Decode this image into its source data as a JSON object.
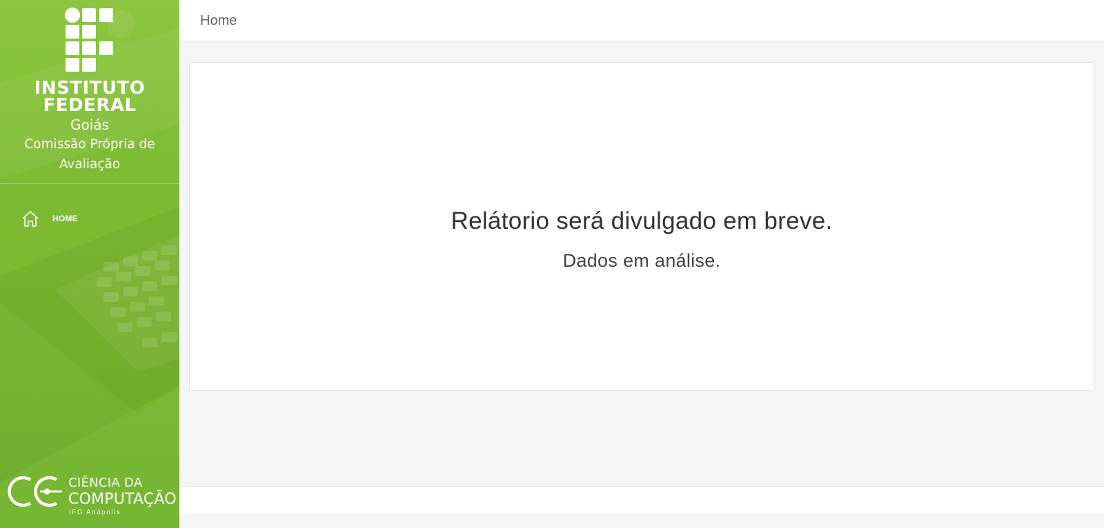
{
  "sidebar": {
    "institution_name": "INSTITUTO FEDERAL",
    "institution_line1": "INSTITUTO",
    "institution_line2": "FEDERAL",
    "campus": "Goiás",
    "commission": "Comissão Própria de Avaliação",
    "nav": [
      {
        "label": "HOME",
        "icon": "home-icon"
      }
    ],
    "footer_logo": {
      "line1": "CIÊNCIA DA",
      "line2": "COMPUTAÇÃO",
      "line3": "IFG Anápolis"
    },
    "colors": {
      "primary": "#7dbb32",
      "light": "#8cc63f"
    }
  },
  "header": {
    "breadcrumb": "Home"
  },
  "main": {
    "title": "Relátorio será divulgado em breve.",
    "subtitle": "Dados em análise."
  }
}
